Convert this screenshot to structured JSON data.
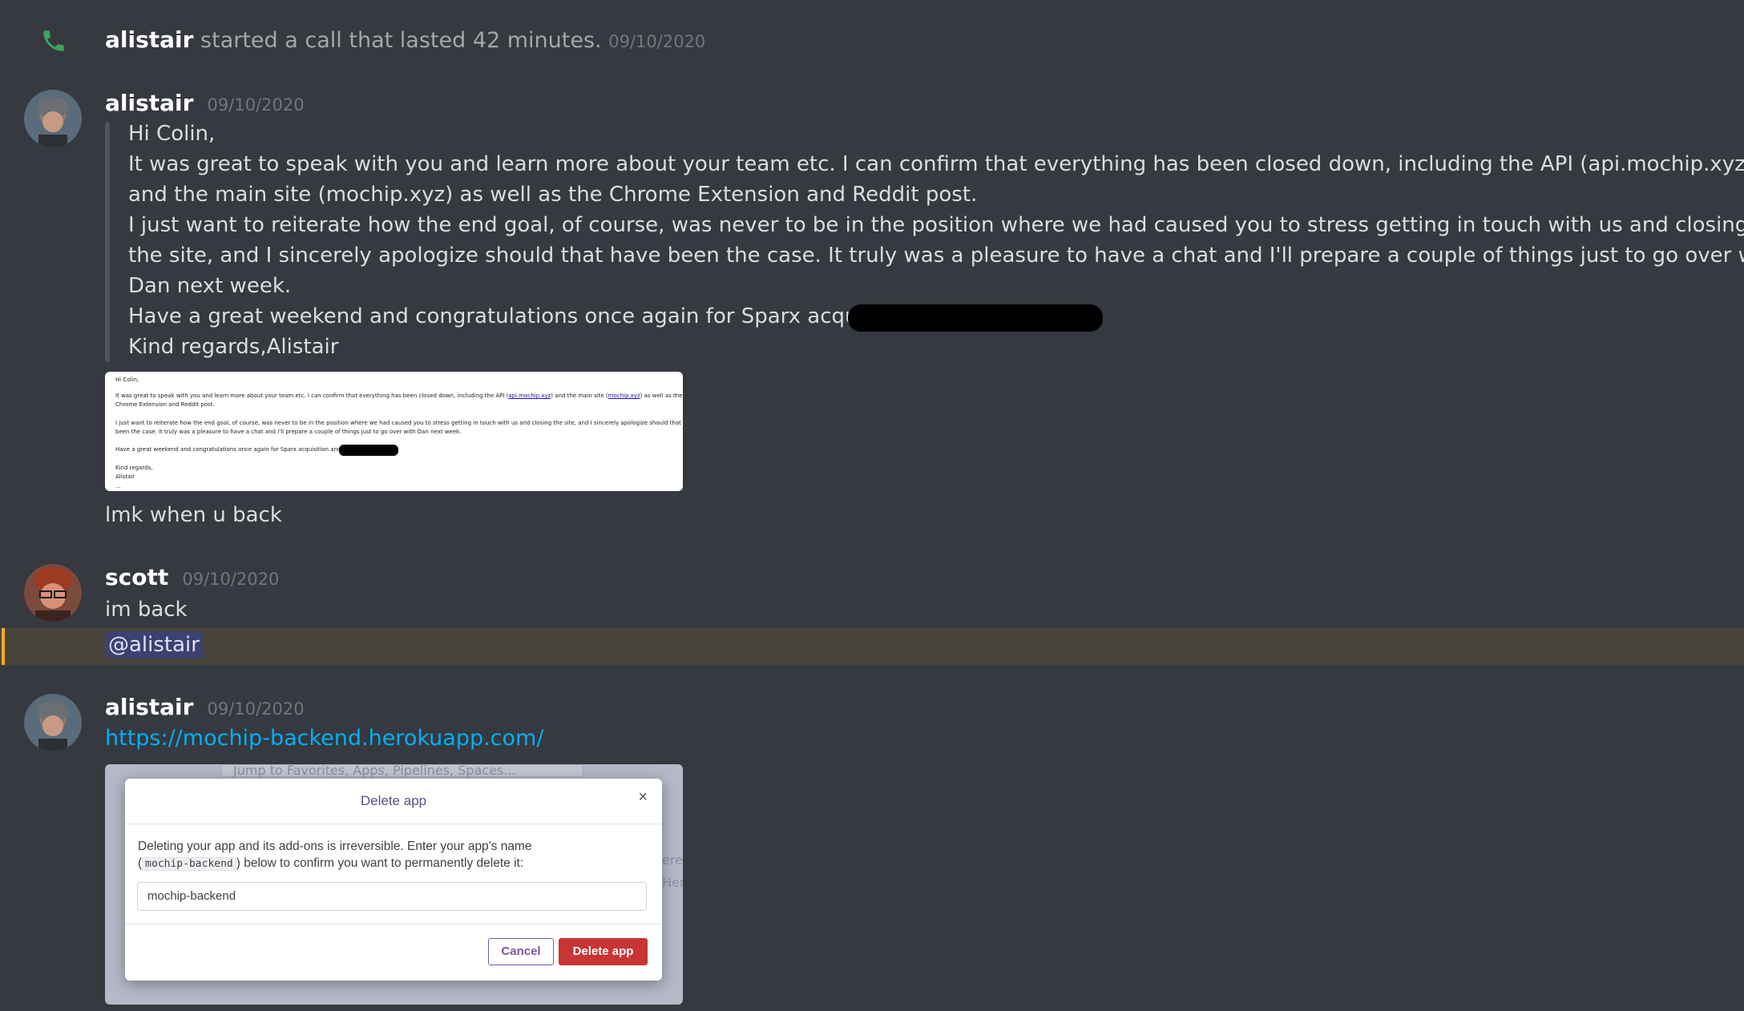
{
  "call": {
    "author": "alistair",
    "text": "started a call that lasted 42 minutes.",
    "timestamp": "09/10/2020",
    "icon": "phone-icon",
    "icon_color": "#3ba55c"
  },
  "messages": [
    {
      "author": "alistair",
      "timestamp": "09/10/2020",
      "quote_lines": [
        "Hi Colin,",
        "It was great to speak with you and learn more about your team etc. I can confirm that everything has been closed down, including the API (api.mochip.xyz)",
        "and the main site (mochip.xyz) as well as the Chrome Extension and Reddit post.",
        "I just want to reiterate how the end goal, of course, was never to be in the position where we had caused you to stress getting in touch with us and closing",
        "the site, and I sincerely apologize should that have been the case. It truly was a pleasure to have a chat and I'll prepare a couple of things just to go over with",
        "Dan next week.",
        "Have a great weekend and congratulations once again for Sparx acquisition",
        "Kind regards,Alistair"
      ],
      "attachment": {
        "lines": [
          "Hi Colin,",
          "It was great to speak with you and learn more about your team etc. I can confirm that everything has been closed down, including the API (",
          "api.mochip.xyz",
          ") and the main site (",
          "mochip.xyz",
          ") as well as the",
          "Chrome Extension and Reddit post.",
          "I just want to reiterate how the end goal, of course, was never to be in the position where we had caused you to stress getting in touch with us and closing the site, and I sincerely apologize should that have",
          "been the case. It truly was a pleasure to have a chat and I'll prepare a couple of things just to go over with Dan next week.",
          "Have a great weekend and congratulations once again for Sparx acquisition and th",
          "Kind regards,",
          "Alistair",
          "..."
        ]
      },
      "followup": "lmk when u back"
    },
    {
      "author": "scott",
      "timestamp": "09/10/2020",
      "text": "im back",
      "mention": "@alistair"
    },
    {
      "author": "alistair",
      "timestamp": "09/10/2020",
      "link": "https://mochip-backend.herokuapp.com/",
      "attachment": {
        "bg_hint": "Jump to Favorites, Apps, Pipelines, Spaces...",
        "bg_side": "ere",
        "bg_side2": "Hero",
        "modal_title": "Delete app",
        "modal_close": "×",
        "desc1": "Deleting your app and its add-ons is irreversible. Enter your app's name",
        "desc2_pre": "(",
        "desc2_code": "mochip-backend",
        "desc2_post": ") below to confirm you want to permanently delete it:",
        "input_value": "mochip-backend",
        "cancel_label": "Cancel",
        "delete_label": "Delete app"
      }
    }
  ]
}
